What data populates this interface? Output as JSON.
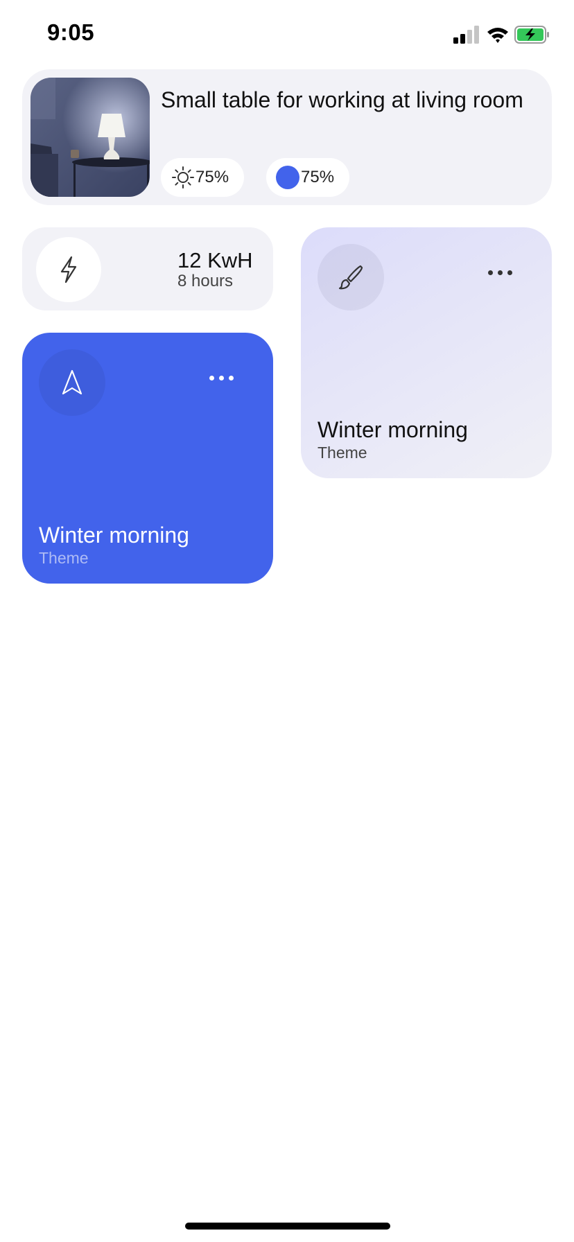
{
  "status_bar": {
    "time": "9:05",
    "battery_color": "#34c759"
  },
  "device": {
    "title": "Small table for working at living room",
    "brightness": "75%",
    "color_level": "75%",
    "color_swatch": "#4263eb"
  },
  "energy": {
    "value": "12 KwH",
    "duration": "8 hours",
    "icon": "lightning-icon"
  },
  "themes": [
    {
      "name": "Winter morning",
      "subtitle": "Theme",
      "icon": "paintbrush-icon",
      "background": "#e3e3f8"
    },
    {
      "name": "Winter morning",
      "subtitle": "Theme",
      "icon": "navigation-arrow-icon",
      "background": "#4263eb"
    }
  ]
}
